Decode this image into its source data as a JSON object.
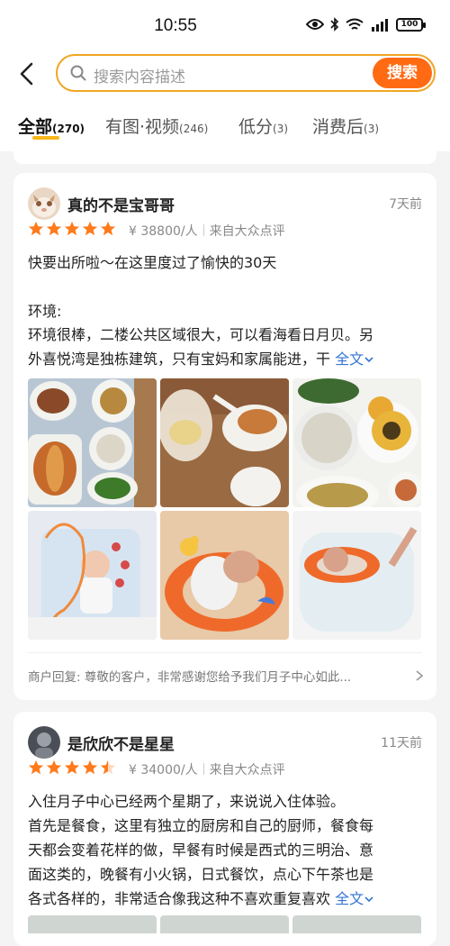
{
  "status": {
    "time": "10:55",
    "battery": "100"
  },
  "search": {
    "placeholder": "搜索内容描述",
    "button_label": "搜索"
  },
  "tabs": [
    {
      "label": "全部",
      "count": "(270)"
    },
    {
      "label": "有图·视频",
      "count": "(246)"
    },
    {
      "label": "低分",
      "count": "(3)"
    },
    {
      "label": "消费后",
      "count": "(3)"
    }
  ],
  "reviews": [
    {
      "username": "真的不是宝哥哥",
      "time": "7天前",
      "rating": 5,
      "price": "¥ 38800/人",
      "source": "来自大众点评",
      "line1": "快要出所啦～在这里度过了愉快的30天",
      "line2": "环境:",
      "line3": "环境很棒，二楼公共区域很大，可以看海看日月贝。另",
      "line4": "外喜悦湾是独栋建筑，只有宝妈和家属能进，干",
      "expand": "全文",
      "reply": "商户回复: 尊敬的客户，非常感谢您给予我们月子中心如此..."
    },
    {
      "username": "是欣欣不是星星",
      "time": "11天前",
      "rating": 4.5,
      "price": "¥ 34000/人",
      "source": "来自大众点评",
      "line1": "入住月子中心已经两个星期了，来说说入住体验。",
      "line2": "首先是餐食，这里有独立的厨房和自己的厨师，餐食每",
      "line3": "天都会变着花样的做，早餐有时候是西式的三明治、意",
      "line4": "面这类的，晚餐有小火锅，日式餐饮，点心下午茶也是",
      "line5": "各式各样的，非常适合像我这种不喜欢重复喜欢",
      "expand": "全文"
    }
  ],
  "colors": {
    "accent": "#ff6a13",
    "star": "#ff7a1a",
    "tab_underline": "#f7b71a",
    "link": "#3474d4"
  }
}
